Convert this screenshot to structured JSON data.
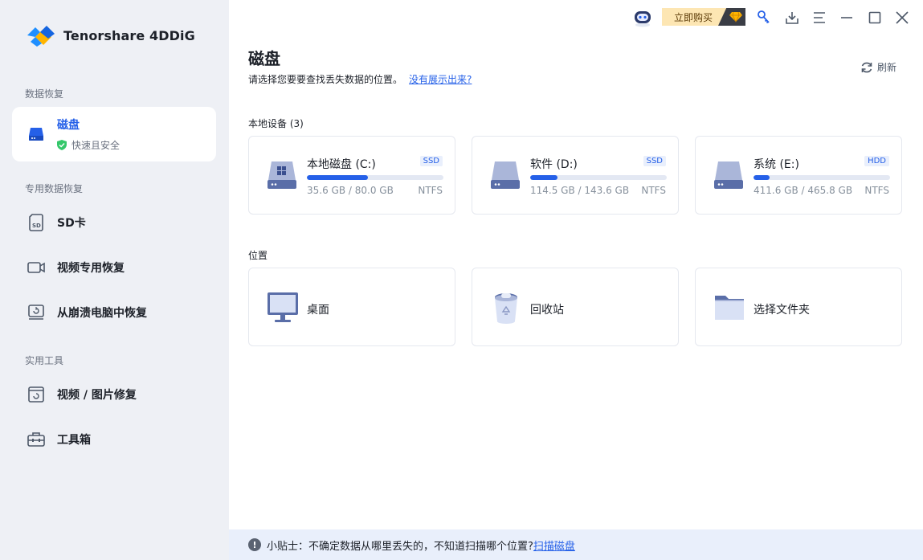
{
  "app": {
    "name": "Tenorshare 4DDiG"
  },
  "sidebar": {
    "sections": [
      {
        "title": "数据恢复"
      },
      {
        "title": "专用数据恢复"
      },
      {
        "title": "实用工具"
      }
    ],
    "items": [
      {
        "label": "磁盘",
        "sub": "快速且安全",
        "icon": "hard-drive-icon",
        "active": true
      },
      {
        "label": "SD卡",
        "icon": "sd-card-icon"
      },
      {
        "label": "视频专用恢复",
        "icon": "video-camera-icon"
      },
      {
        "label": "从崩溃电脑中恢复",
        "icon": "crashed-computer-icon"
      },
      {
        "label": "视频 / 图片修复",
        "icon": "photo-repair-icon"
      },
      {
        "label": "工具箱",
        "icon": "toolbox-icon"
      }
    ]
  },
  "titlebar": {
    "buy_label": "立即购买"
  },
  "main": {
    "title": "磁盘",
    "subtitle": "请选择您要要查找丢失数据的位置。",
    "help_link": "没有展示出来?",
    "refresh_label": "刷新",
    "local_devices_title": "本地设备 (3)",
    "locations_title": "位置"
  },
  "drives": [
    {
      "name": "本地磁盘 (C:)",
      "badge": "SSD",
      "size": "35.6 GB / 80.0 GB",
      "fs": "NTFS",
      "usage": 0.445
    },
    {
      "name": "软件 (D:)",
      "badge": "SSD",
      "size": "114.5 GB / 143.6 GB",
      "fs": "NTFS",
      "usage": 0.2
    },
    {
      "name": "系统 (E:)",
      "badge": "HDD",
      "size": "411.6 GB / 465.8 GB",
      "fs": "NTFS",
      "usage": 0.12
    }
  ],
  "locations": [
    {
      "name": "桌面",
      "icon": "desktop-monitor-icon"
    },
    {
      "name": "回收站",
      "icon": "recycle-bin-icon"
    },
    {
      "name": "选择文件夹",
      "icon": "folder-icon"
    }
  ],
  "tip": {
    "text": "小贴士：不确定数据从哪里丢失的，不知道扫描哪个位置?",
    "link": "扫描磁盘"
  },
  "colors": {
    "accent": "#2560e8",
    "sidebar_bg": "#eef0f5",
    "tip_bg": "#e9effb",
    "buy_bg": "#fde6b3"
  }
}
